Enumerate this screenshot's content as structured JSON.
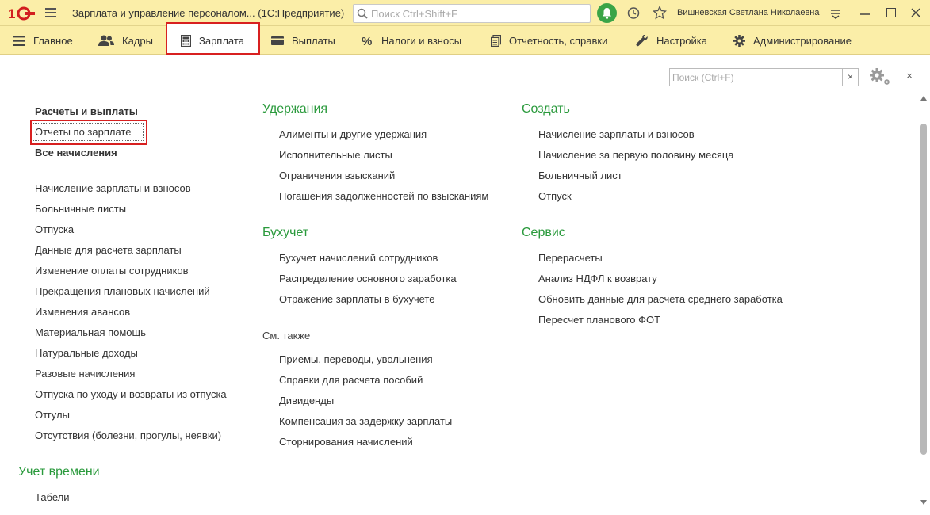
{
  "app": {
    "title": "Зарплата и управление персоналом... (1С:Предприятие)",
    "search_placeholder": "Поиск Ctrl+Shift+F",
    "user": "Вишневская Светлана Николаевна",
    "logo_text": "1С"
  },
  "sections": [
    {
      "label": "Главное",
      "icon": "menu-icon"
    },
    {
      "label": "Кадры",
      "icon": "people-icon"
    },
    {
      "label": "Зарплата",
      "icon": "calculator-icon",
      "active": true
    },
    {
      "label": "Выплаты",
      "icon": "wallet-icon"
    },
    {
      "label": "Налоги и взносы",
      "icon": "percent-icon"
    },
    {
      "label": "Отчетность, справки",
      "icon": "documents-icon"
    },
    {
      "label": "Настройка",
      "icon": "wrench-icon"
    },
    {
      "label": "Администрирование",
      "icon": "gear-icon"
    }
  ],
  "panel": {
    "search_placeholder": "Поиск (Ctrl+F)",
    "clear_label": "×",
    "close_label": "×"
  },
  "col1": {
    "top_links": [
      "Расчеты и выплаты",
      "Отчеты по зарплате",
      "Все начисления"
    ],
    "links": [
      "Начисление зарплаты и взносов",
      "Больничные листы",
      "Отпуска",
      "Данные для расчета зарплаты",
      "Изменение оплаты сотрудников",
      "Прекращения плановых начислений",
      "Изменения авансов",
      "Материальная помощь",
      "Натуральные доходы",
      "Разовые начисления",
      "Отпуска по уходу и возвраты из отпуска",
      "Отгулы",
      "Отсутствия (болезни, прогулы, неявки)"
    ],
    "time_group": "Учет времени",
    "time_links": [
      "Табели"
    ]
  },
  "col2": {
    "deductions_title": "Удержания",
    "deductions": [
      "Алименты и другие удержания",
      "Исполнительные листы",
      "Ограничения взысканий",
      "Погашения задолженностей по взысканиям"
    ],
    "accounting_title": "Бухучет",
    "accounting": [
      "Бухучет начислений сотрудников",
      "Распределение основного заработка",
      "Отражение зарплаты в бухучете"
    ],
    "see_also_title": "См. также",
    "see_also": [
      "Приемы, переводы, увольнения",
      "Справки для расчета пособий",
      "Дивиденды",
      "Компенсация за задержку зарплаты",
      "Сторнирования начислений"
    ]
  },
  "col3": {
    "create_title": "Создать",
    "create": [
      "Начисление зарплаты и взносов",
      "Начисление за первую половину месяца",
      "Больничный лист",
      "Отпуск"
    ],
    "service_title": "Сервис",
    "service": [
      "Перерасчеты",
      "Анализ НДФЛ к возврату",
      "Обновить данные для расчета среднего заработка",
      "Пересчет планового ФОТ"
    ]
  },
  "colors": {
    "titlebar_bg": "#fbeea8",
    "group_title": "#2a9a3c",
    "highlight": "#d82020",
    "bell": "#3aa447"
  }
}
